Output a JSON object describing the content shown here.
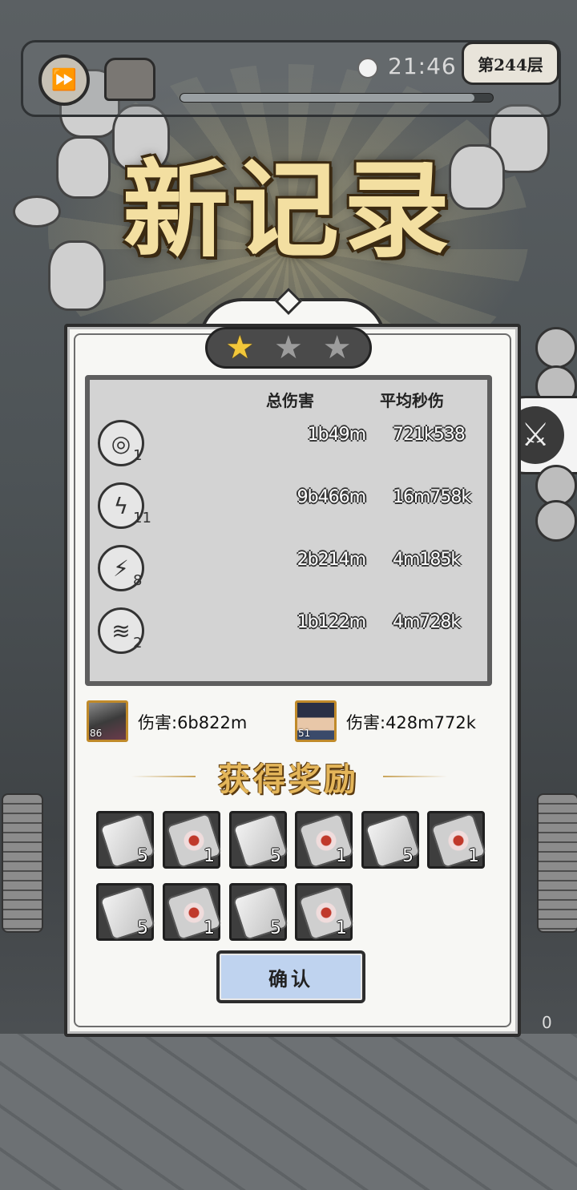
{
  "hud": {
    "timer": "21:46",
    "floor_badge": "第244层",
    "progress": 0.94,
    "fast_forward_icon": "fast-forward-icon",
    "chest_icon": "treasure-chest-icon",
    "clock_icon": "clock-icon"
  },
  "banner_title": "新记录",
  "stars": {
    "earned": 1,
    "total": 3
  },
  "stats": {
    "headers": {
      "total": "总伤害",
      "dps": "平均秒伤"
    },
    "skills": [
      {
        "icon": "saw-blade-icon",
        "level": "1",
        "total": "1b49m",
        "dps": "721k538"
      },
      {
        "icon": "lightning-orb-icon",
        "level": "11",
        "total": "9b466m",
        "dps": "16m758k"
      },
      {
        "icon": "chain-lightning-icon",
        "level": "8",
        "total": "2b214m",
        "dps": "4m185k"
      },
      {
        "icon": "drill-icon",
        "level": "2",
        "total": "1b122m",
        "dps": "4m728k"
      }
    ]
  },
  "heroes": [
    {
      "level": "86",
      "damage": "伤害:6b822m"
    },
    {
      "level": "51",
      "damage": "伤害:428m772k"
    }
  ],
  "rewards": {
    "title": "获得奖励",
    "items": [
      {
        "type": "steel-ingot",
        "count": "5"
      },
      {
        "type": "red-core-ore",
        "count": "1"
      },
      {
        "type": "steel-ingot",
        "count": "5"
      },
      {
        "type": "red-core-ore",
        "count": "1"
      },
      {
        "type": "steel-ingot",
        "count": "5"
      },
      {
        "type": "red-core-ore",
        "count": "1"
      },
      {
        "type": "steel-ingot",
        "count": "5"
      },
      {
        "type": "red-core-ore",
        "count": "1"
      },
      {
        "type": "steel-ingot",
        "count": "5"
      },
      {
        "type": "red-core-ore",
        "count": "1"
      }
    ]
  },
  "confirm_label": "确认",
  "side_button_icon": "crossed-swords-icon",
  "corner_counter": "0",
  "colors": {
    "title_gold": "#f3dfa1",
    "confirm_blue": "#bfd3ef",
    "star_gold": "#f3c83a"
  }
}
